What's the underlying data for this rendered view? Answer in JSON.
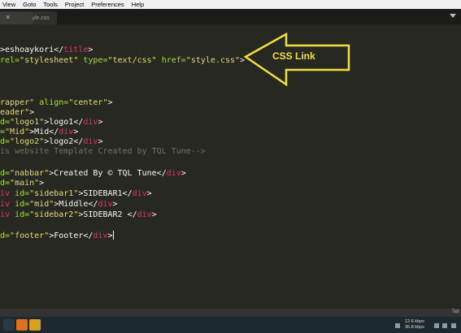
{
  "menu": [
    "View",
    "Goto",
    "Tools",
    "Project",
    "Preferences",
    "Help"
  ],
  "tabs": {
    "active_close": "×",
    "second": "style.css"
  },
  "code": {
    "l1": {
      "a": ">eshoaykori</",
      "b": "title",
      "c": ">"
    },
    "l2": {
      "a": "rel=",
      "b": "\"stylesheet\"",
      "c": " type=",
      "d": "\"text/css\"",
      "e": " href=",
      "f": "\"style.css\"",
      "g": ">"
    },
    "l3": {
      "a": "rapper\"",
      "b": " align=",
      "c": "\"center\"",
      "d": ">"
    },
    "l4": {
      "a": "eader\"",
      "b": ">"
    },
    "l5": {
      "a": "d=",
      "b": "\"logo1\"",
      "c": ">logo1</",
      "d": "div",
      "e": ">"
    },
    "l6": {
      "a": "=",
      "b": "\"Mid\"",
      "c": ">Mid</",
      "d": "div",
      "e": ">"
    },
    "l7": {
      "a": "d=",
      "b": "\"logo2\"",
      "c": ">logo2</",
      "d": "div",
      "e": ">"
    },
    "l8": "is website Template Created by TQL Tune-->",
    "l9": {
      "a": "d=",
      "b": "\"nabbar\"",
      "c": ">Created By © TQL Tune</",
      "d": "div",
      "e": ">"
    },
    "l10": {
      "a": "d=",
      "b": "\"main\"",
      "c": ">"
    },
    "l11": {
      "a": "iv",
      "b": " id=",
      "c": "\"sidebar1\"",
      "d": ">SIDEBAR1</",
      "e": "div",
      "f": ">"
    },
    "l12": {
      "a": "iv",
      "b": " id=",
      "c": "\"mid\"",
      "d": ">Middle</",
      "e": "div",
      "f": ">"
    },
    "l13": {
      "a": "iv",
      "b": " id=",
      "c": "\"sidebar2\"",
      "d": ">SIDEBAR2 </",
      "e": "div",
      "f": ">"
    },
    "l14": {
      "a": "d=",
      "b": "\"footer\"",
      "c": ">Footer</",
      "d": "div",
      "e": ">"
    }
  },
  "annotation": "CSS Link",
  "status_right": "Tab",
  "network": {
    "up": "12.6 kbps",
    "down": "36.8 kbps"
  },
  "colors": {
    "annotation": "#f0e040",
    "tag": "#f92672",
    "string": "#e6db74",
    "comment": "#75715e"
  }
}
